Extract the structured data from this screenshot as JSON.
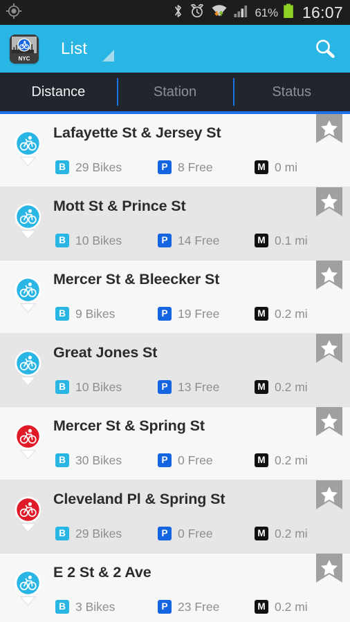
{
  "status_bar": {
    "location_icon": "gps-crosshair-icon",
    "icons": [
      "bluetooth-icon",
      "alarm-icon",
      "wifi-icon",
      "cellular-signal-icon"
    ],
    "battery_percent": "61%",
    "clock": "16:07"
  },
  "action_bar": {
    "app_icon_label": "NYC",
    "title": "List",
    "search_icon": "search-icon",
    "dropdown_icon": "dropdown-triangle-icon",
    "background_color": "#2ab6e4"
  },
  "tabs": [
    {
      "label": "Distance",
      "active": true
    },
    {
      "label": "Station",
      "active": false
    },
    {
      "label": "Status",
      "active": false
    }
  ],
  "tab_accent_color": "#1b72e8",
  "badges": {
    "bikes": "B",
    "free": "P",
    "distance": "M"
  },
  "stations": [
    {
      "name": "Lafayette St & Jersey St",
      "bikes": "29 Bikes",
      "free": "8 Free",
      "distance": "0 mi",
      "pin_color": "#2ab6e4",
      "favorite": false
    },
    {
      "name": "Mott St & Prince St",
      "bikes": "10 Bikes",
      "free": "14 Free",
      "distance": "0.1 mi",
      "pin_color": "#2ab6e4",
      "favorite": false
    },
    {
      "name": "Mercer St & Bleecker St",
      "bikes": "9 Bikes",
      "free": "19 Free",
      "distance": "0.2 mi",
      "pin_color": "#2ab6e4",
      "favorite": false
    },
    {
      "name": "Great Jones St",
      "bikes": "10 Bikes",
      "free": "13 Free",
      "distance": "0.2 mi",
      "pin_color": "#2ab6e4",
      "favorite": false
    },
    {
      "name": "Mercer St & Spring St",
      "bikes": "30 Bikes",
      "free": "0 Free",
      "distance": "0.2 mi",
      "pin_color": "#e01b27",
      "favorite": false
    },
    {
      "name": "Cleveland Pl & Spring St",
      "bikes": "29 Bikes",
      "free": "0 Free",
      "distance": "0.2 mi",
      "pin_color": "#e01b27",
      "favorite": false
    },
    {
      "name": "E 2 St & 2 Ave",
      "bikes": "3 Bikes",
      "free": "23 Free",
      "distance": "0.2 mi",
      "pin_color": "#2ab6e4",
      "favorite": false
    }
  ]
}
